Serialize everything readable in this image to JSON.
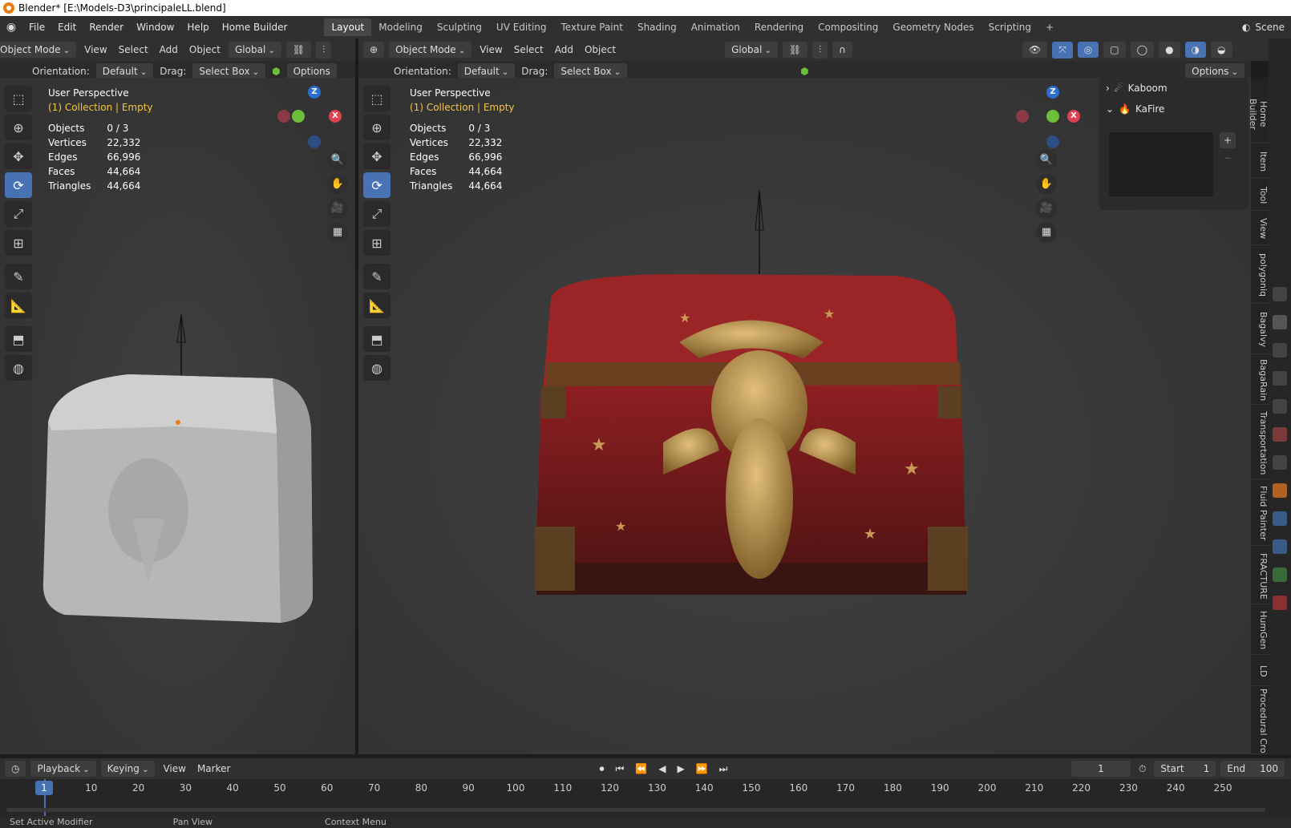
{
  "window_title": "Blender* [E:\\Models-D3\\principaleLL.blend]",
  "menu": [
    "File",
    "Edit",
    "Render",
    "Window",
    "Help",
    "Home Builder"
  ],
  "workspaces": [
    "Layout",
    "Modeling",
    "Sculpting",
    "UV Editing",
    "Texture Paint",
    "Shading",
    "Animation",
    "Rendering",
    "Compositing",
    "Geometry Nodes",
    "Scripting"
  ],
  "active_workspace": "Layout",
  "scene_label": "Scene",
  "left_header": {
    "mode": "Object Mode",
    "menus": [
      "View",
      "Select",
      "Add",
      "Object"
    ],
    "transform": "Global",
    "orientation_label": "Orientation:",
    "orientation": "Default",
    "drag_label": "Drag:",
    "drag": "Select Box",
    "options": "Options"
  },
  "right_header": {
    "mode": "Object Mode",
    "menus": [
      "View",
      "Select",
      "Add",
      "Object"
    ],
    "transform": "Global",
    "orientation_label": "Orientation:",
    "orientation": "Default",
    "drag_label": "Drag:",
    "drag": "Select Box",
    "options": "Options"
  },
  "viewport_info": {
    "perspective": "User Perspective",
    "collection": "(1) Collection | Empty",
    "stats": [
      {
        "label": "Objects",
        "value": "0 / 3"
      },
      {
        "label": "Vertices",
        "value": "22,332"
      },
      {
        "label": "Edges",
        "value": "66,996"
      },
      {
        "label": "Faces",
        "value": "44,664"
      },
      {
        "label": "Triangles",
        "value": "44,664"
      }
    ]
  },
  "gizmo_axes": {
    "z": "Z",
    "x": "X"
  },
  "n_panel": {
    "items": [
      "Kaboom",
      "KaFire"
    ]
  },
  "side_tabs": [
    "Home Builder",
    "Item",
    "Tool",
    "View",
    "polygoniq",
    "Bagalvy",
    "BagaRain",
    "Transportation",
    "Fluid Painter",
    "FRACTURE",
    "HumGen",
    "LD",
    "Procedural Cro"
  ],
  "timeline": {
    "menus": [
      "Playback",
      "Keying",
      "View",
      "Marker"
    ],
    "current_frame": "1",
    "start_label": "Start",
    "start": "1",
    "end_label": "End",
    "end": "100",
    "ticks": [
      "10",
      "20",
      "30",
      "40",
      "50",
      "60",
      "70",
      "80",
      "90",
      "100",
      "110",
      "120",
      "130",
      "140",
      "150",
      "160",
      "170",
      "180",
      "190",
      "200",
      "210",
      "220",
      "230",
      "240",
      "250"
    ],
    "cursor_frame": "1"
  },
  "status_bar": [
    "Set Active Modifier",
    "Pan View",
    "Context Menu"
  ],
  "colors": {
    "accent": "#4772b3",
    "collection_text": "#f5c542",
    "x_axis": "#e04050",
    "y_axis": "#6bbf3a",
    "z_axis": "#2a6fd0"
  }
}
